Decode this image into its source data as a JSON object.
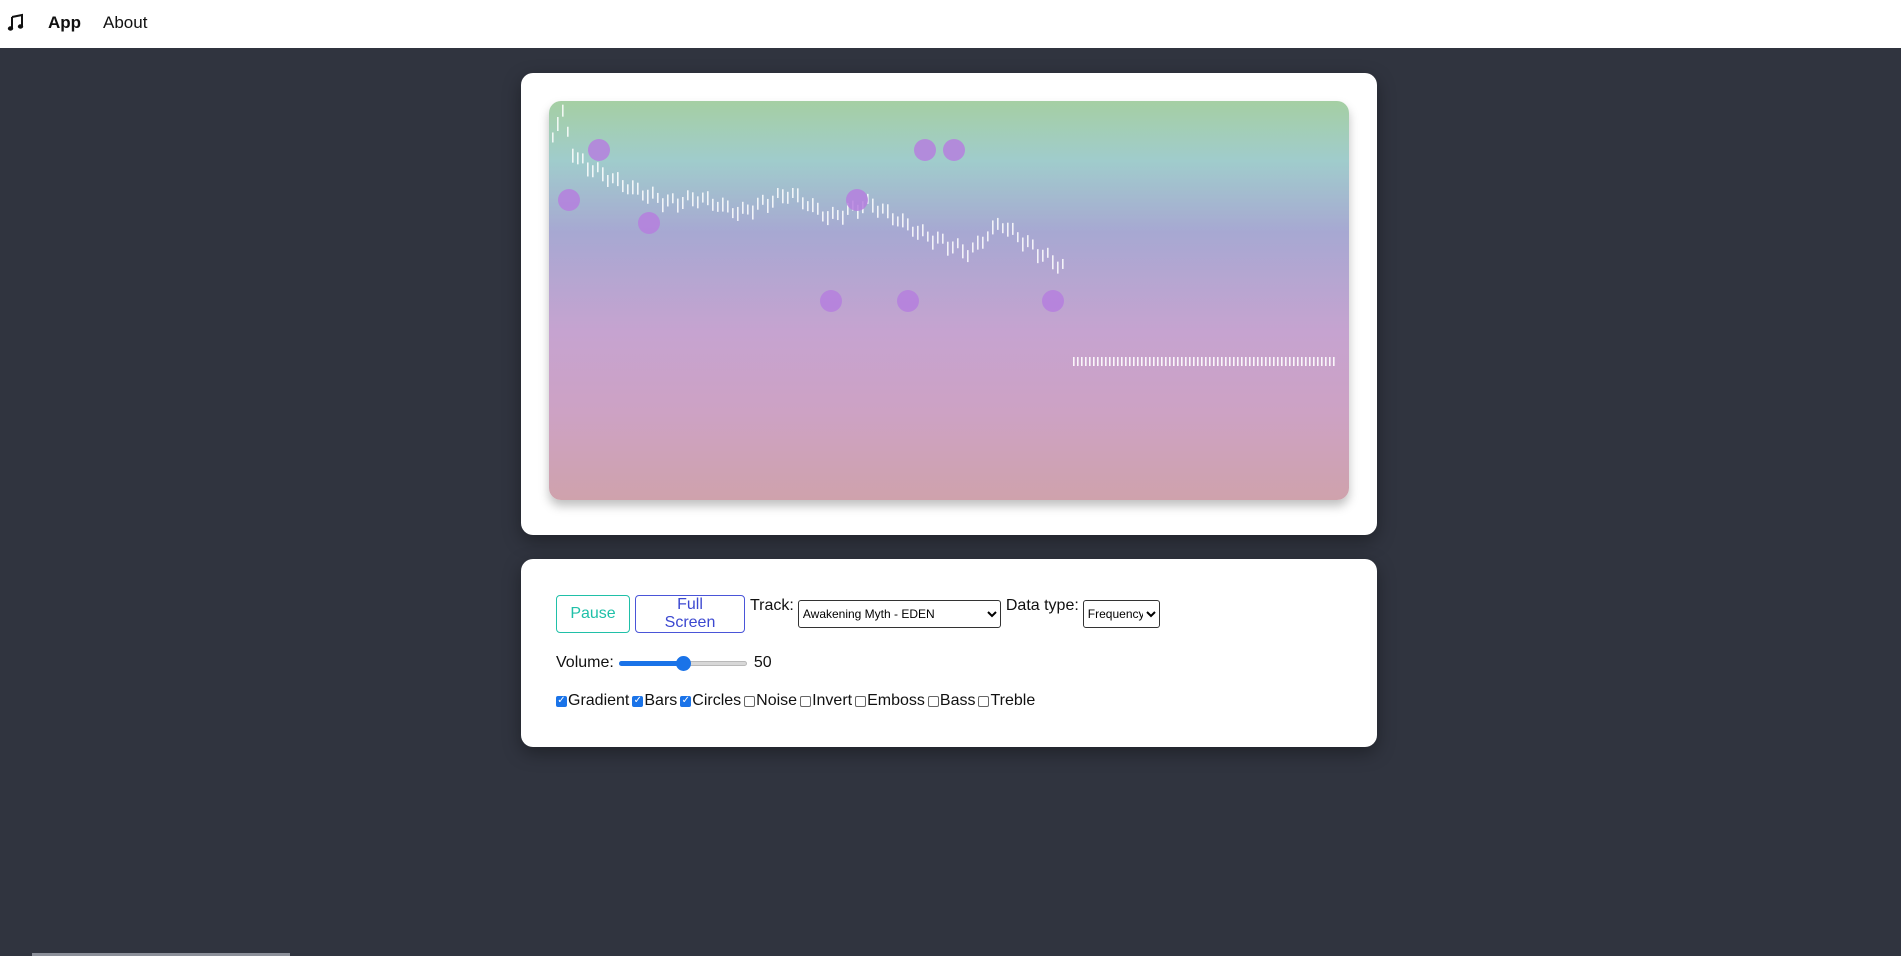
{
  "nav": {
    "logo_icon": "music-note-icon",
    "app_label": "App",
    "about_label": "About"
  },
  "visualizer": {
    "gradient_colors": [
      "#a5cfa3",
      "#a0cccc",
      "#a7a8d2",
      "#c6a3d0",
      "#cda2c4",
      "#cfa2ac"
    ],
    "circle_color": "#b57fde",
    "bar_color": "#ffffff"
  },
  "controls": {
    "pause_label": "Pause",
    "fullscreen_label": "Full Screen",
    "track_label": "Track:",
    "track_selected": "Awakening Myth - EDEN",
    "data_type_label": "Data type:",
    "data_type_selected": "Frequency",
    "volume_label": "Volume:",
    "volume_value": "50",
    "volume_fraction": 0.5,
    "options": [
      {
        "label": "Gradient",
        "checked": true
      },
      {
        "label": "Bars",
        "checked": true
      },
      {
        "label": "Circles",
        "checked": true
      },
      {
        "label": "Noise",
        "checked": false
      },
      {
        "label": "Invert",
        "checked": false
      },
      {
        "label": "Emboss",
        "checked": false
      },
      {
        "label": "Bass",
        "checked": false
      },
      {
        "label": "Treble",
        "checked": false
      }
    ]
  }
}
